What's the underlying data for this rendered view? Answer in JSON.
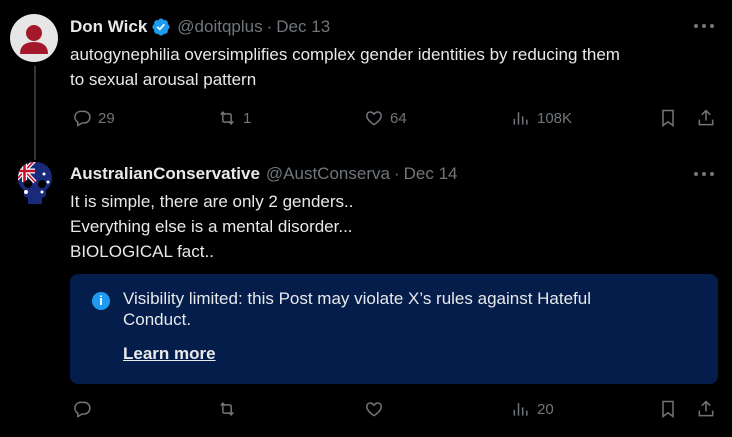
{
  "tweets": [
    {
      "name": "Don Wick",
      "verified": true,
      "handle": "@doitqplus",
      "separator": "·",
      "date": "Dec 13",
      "lines": [
        "autogynephilia oversimplifies complex gender identities by reducing them",
        "to sexual arousal pattern"
      ],
      "actions": {
        "replies": "29",
        "reposts": "1",
        "likes": "64",
        "views": "108K"
      }
    },
    {
      "name": "AustralianConservative",
      "verified": false,
      "handle": "@AustConserva",
      "separator": "·",
      "date": "Dec 14",
      "lines": [
        "It is simple, there are only 2 genders..",
        "Everything else is a mental disorder...",
        "BIOLOGICAL fact.."
      ],
      "notice": {
        "text": "Visibility limited: this Post may violate X’s rules against Hateful Conduct.",
        "link": "Learn more",
        "icon": "info-icon"
      },
      "actions": {
        "replies": "",
        "reposts": "",
        "likes": "",
        "views": "20"
      }
    }
  ],
  "colors": {
    "background": "#000000",
    "text": "#e7e9ea",
    "muted": "#71767b",
    "verified": "#1d9bf0",
    "notice_bg": "#051d4b"
  }
}
